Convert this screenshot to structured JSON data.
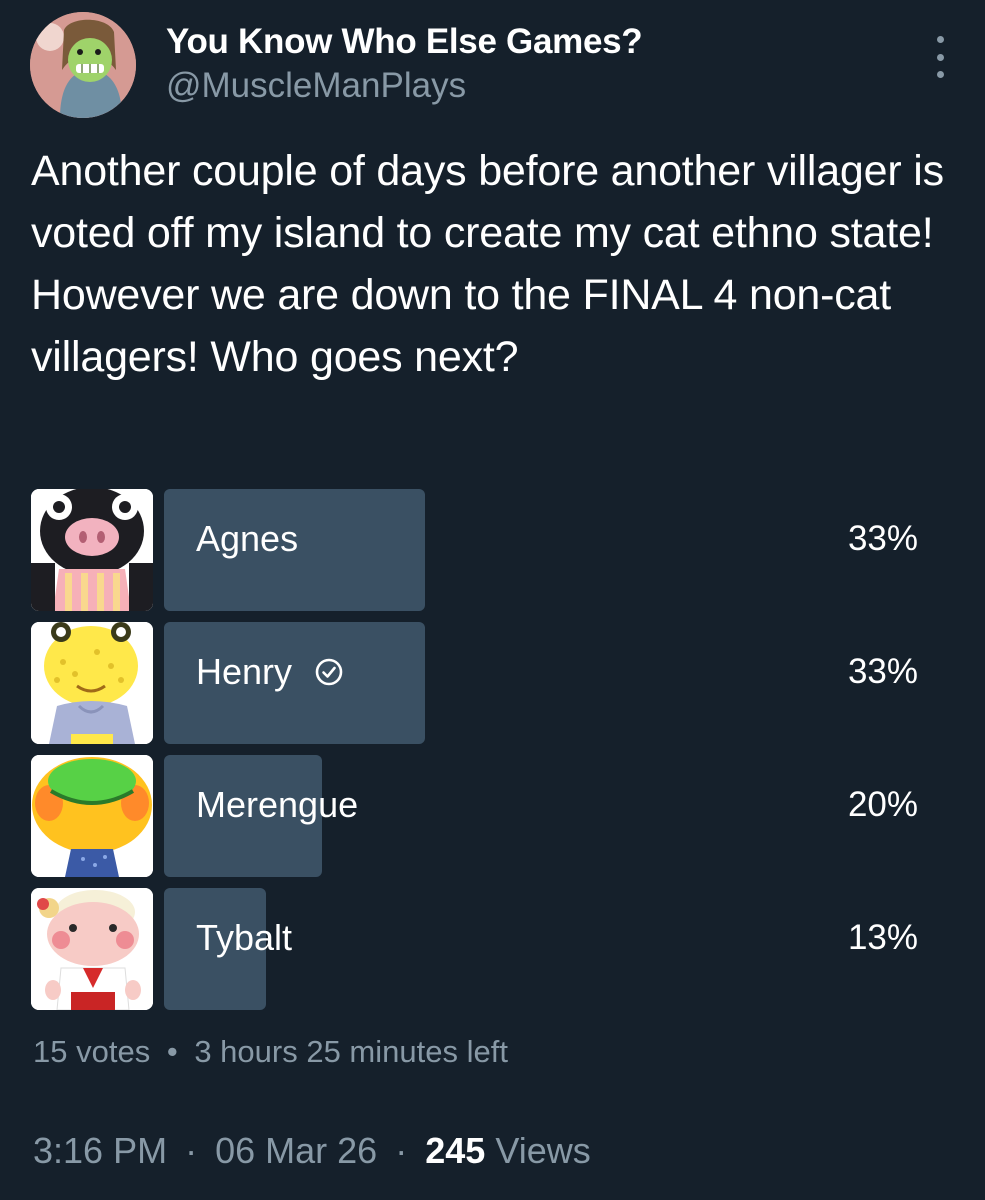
{
  "author": {
    "display_name": "You Know Who Else Games?",
    "handle": "@MuscleManPlays",
    "avatar_icon": "cartoon-avatar"
  },
  "menu_icon": "more-vertical-icon",
  "tweet": {
    "text": "Another couple of days before another villager is voted off my island to create my cat ethno state! However we are down to the FINAL 4 non-cat villagers! Who goes next?"
  },
  "poll": {
    "options": [
      {
        "label": "Agnes",
        "percent_text": "33%",
        "percent": 33,
        "selected": false,
        "thumb_icon": "agnes-villager-icon"
      },
      {
        "label": "Henry",
        "percent_text": "33%",
        "percent": 33,
        "selected": true,
        "thumb_icon": "henry-villager-icon"
      },
      {
        "label": "Merengue",
        "percent_text": "20%",
        "percent": 20,
        "selected": false,
        "thumb_icon": "merengue-villager-icon"
      },
      {
        "label": "Tybalt",
        "percent_text": "13%",
        "percent": 13,
        "selected": false,
        "thumb_icon": "tybalt-villager-icon"
      }
    ],
    "votes": "15 votes",
    "separator": "•",
    "time_left": "3 hours 25 minutes left"
  },
  "meta": {
    "time": "3:16 PM",
    "dot": "·",
    "date": "06 Mar 26",
    "views_count": "245",
    "views_label": "Views"
  },
  "colors": {
    "background": "#15202b",
    "bar": "#3a5063",
    "muted_text": "#8899a6",
    "text": "#ffffff"
  }
}
